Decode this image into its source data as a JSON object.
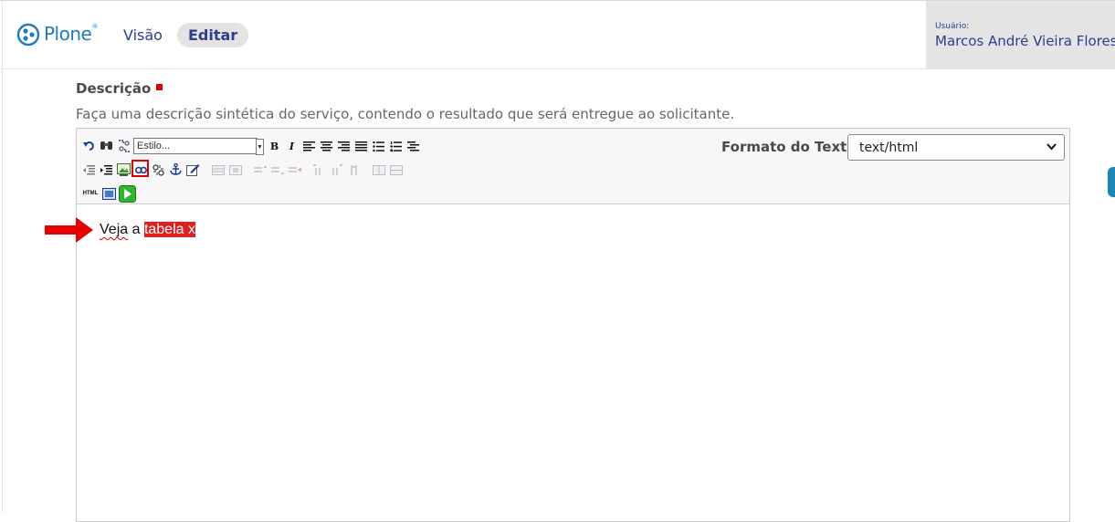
{
  "header": {
    "logo_text": "Plone",
    "logo_mark": "®",
    "nav": [
      {
        "label": "Visão",
        "active": false
      },
      {
        "label": "Editar",
        "active": true
      }
    ],
    "user_label": "Usuário:",
    "user_name": "Marcos André Vieira Flores"
  },
  "field": {
    "label": "Descrição",
    "help": "Faça uma descrição sintética do serviço, contendo o resultado que será entregue ao solicitante."
  },
  "editor": {
    "style_placeholder": "Estilo...",
    "format_label": "Formato do Texto",
    "format_value": "text/html",
    "html_button": "HTML",
    "content_word1": "Veja",
    "content_word2": " a ",
    "content_selected": "tabela x"
  },
  "colors": {
    "accent": "#1f7bbd",
    "nav_text": "#2d3d8f",
    "required": "#e30000",
    "selection": "#e02020",
    "highlight": "#e00000"
  }
}
